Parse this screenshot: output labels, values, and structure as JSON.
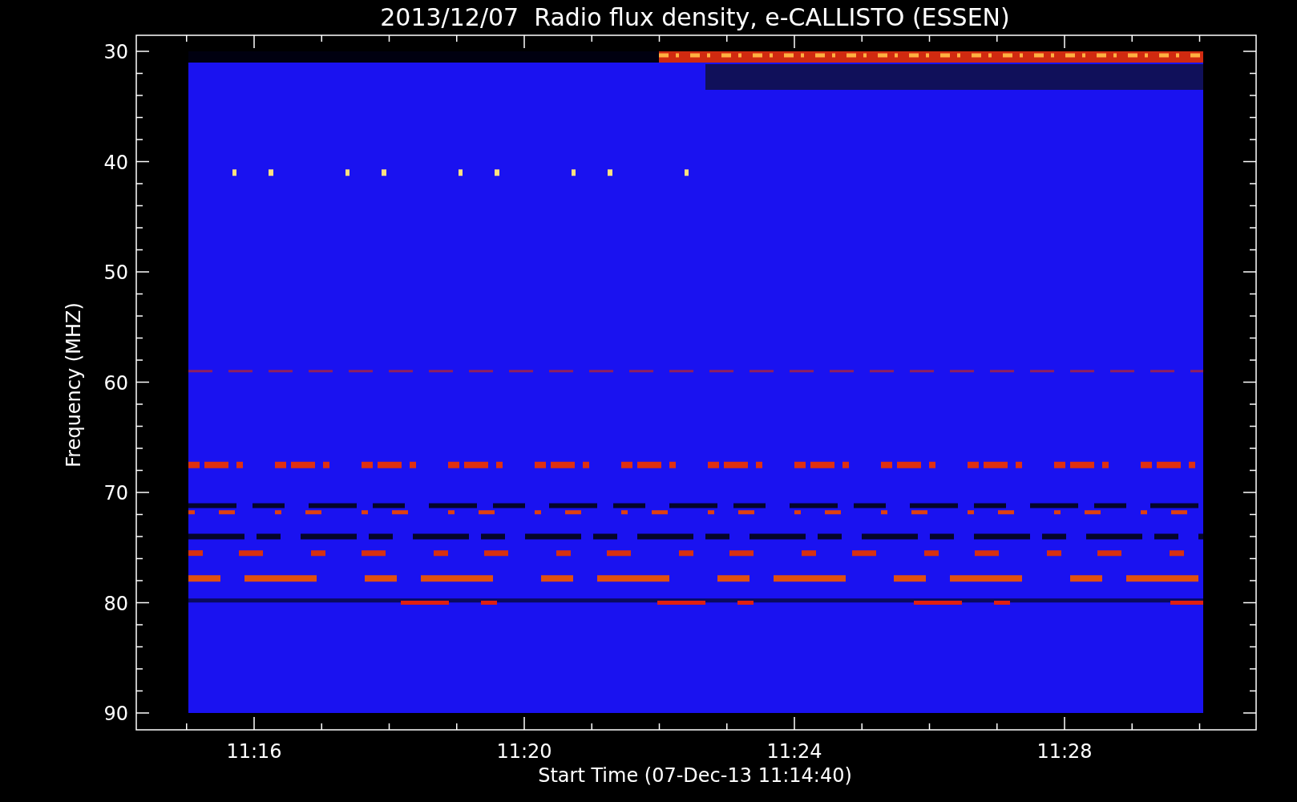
{
  "plot": {
    "title": "2013/12/07  Radio flux density, e-CALLISTO (ESSEN)",
    "xlabel": "Start Time (07-Dec-13 11:14:40)",
    "ylabel": "Frequency (MHZ)",
    "xticks": [
      "11:16",
      "11:20",
      "11:24",
      "11:28"
    ],
    "yticks": [
      "30",
      "40",
      "50",
      "60",
      "70",
      "80",
      "90"
    ]
  }
}
